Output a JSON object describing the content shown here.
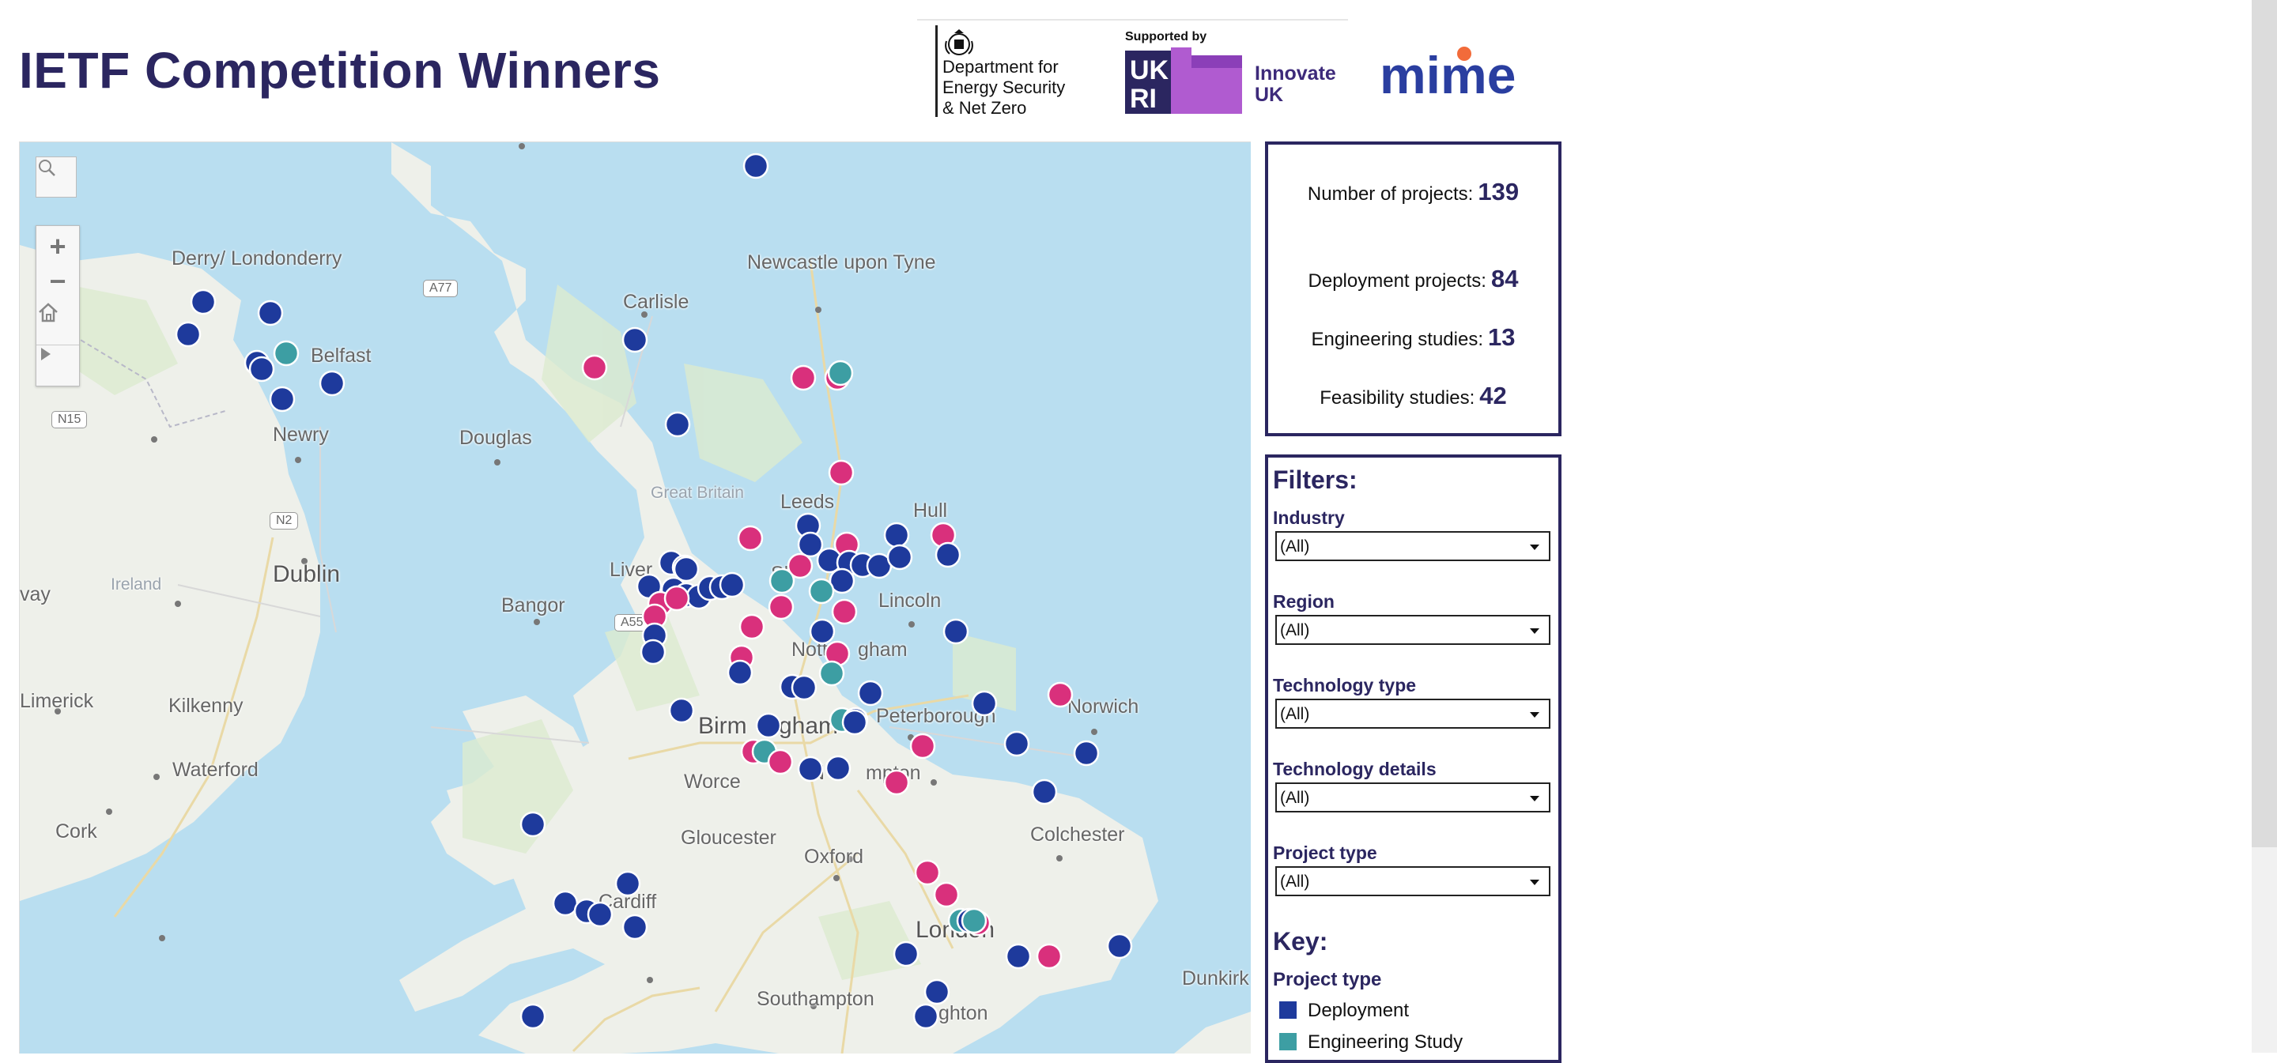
{
  "header": {
    "title": "IETF Competition Winners",
    "desnz_text": "Department for\nEnergy Security\n& Net Zero",
    "supported_by": "Supported by",
    "innovate_text": "Innovate\nUK",
    "ukri_text": "UKRI",
    "mime_text": "mime"
  },
  "map": {
    "controls": [
      "search-icon",
      "zoom-in-icon",
      "zoom-out-icon",
      "home-icon",
      "play-icon"
    ],
    "place_labels": [
      "Derry/\nLondonderry",
      "Belfast",
      "Newry",
      "Dublin",
      "Ireland",
      "Kilkenny",
      "Waterford",
      "Cork",
      "Limerick",
      "vay",
      "Douglas",
      "Carlisle",
      "Newcastle\nupon Tyne",
      "Great Britain",
      "Leeds",
      "Hull",
      "Liver",
      "Sh",
      "Lincoln",
      "Bangor",
      "Nott",
      "gham",
      "Peterborough",
      "Norwich",
      "Birm",
      "gham",
      "Worce",
      "N",
      "mpton",
      "Colchester",
      "Gloucester",
      "Oxford",
      "Cardiff",
      "London",
      "Southampton",
      "ghton",
      "Dunkirk"
    ],
    "road_labels": [
      "A77",
      "N15",
      "N2",
      "A55"
    ],
    "project_colors": {
      "Deployment": "#1e3a9c",
      "Engineering Study": "#3d9ea3",
      "Feasibility Study": "#d9307c"
    }
  },
  "stats": {
    "projects_label": "Number of projects:",
    "projects_value": "139",
    "deployment_label": "Deployment projects:",
    "deployment_value": "84",
    "engineering_label": "Engineering studies:",
    "engineering_value": "13",
    "feasibility_label": "Feasibility studies:",
    "feasibility_value": "42"
  },
  "filters": {
    "heading": "Filters:",
    "items": [
      {
        "label": "Industry",
        "value": "(All)"
      },
      {
        "label": "Region",
        "value": "(All)"
      },
      {
        "label": "Technology type",
        "value": "(All)"
      },
      {
        "label": "Technology details",
        "value": "(All)"
      },
      {
        "label": "Project type",
        "value": "(All)"
      }
    ]
  },
  "key": {
    "heading": "Key:",
    "subheading": "Project type",
    "items": [
      {
        "label": "Deployment",
        "color": "#1e3a9c"
      },
      {
        "label": "Engineering Study",
        "color": "#3d9ea3"
      }
    ]
  }
}
